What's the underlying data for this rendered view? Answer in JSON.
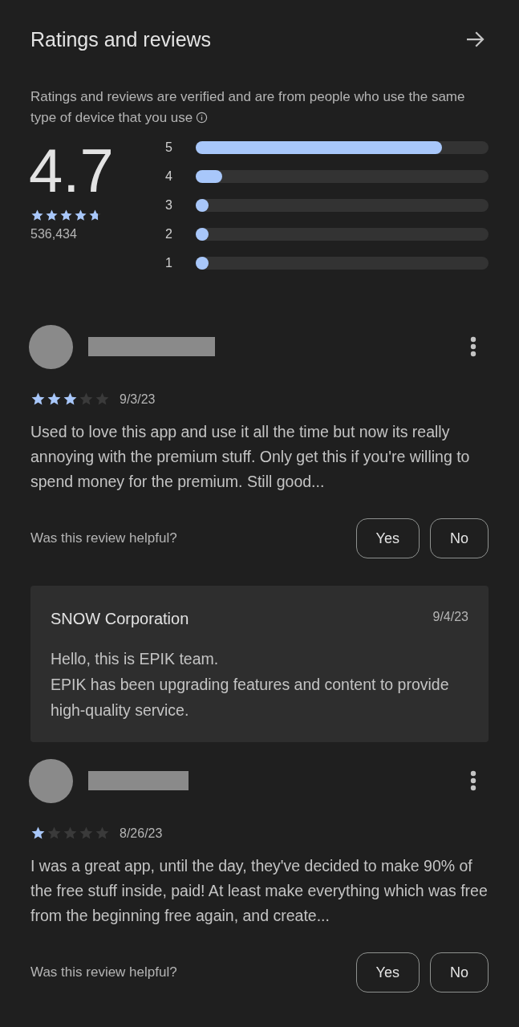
{
  "header": {
    "title": "Ratings and reviews"
  },
  "notice": "Ratings and reviews are verified and are from people who use the same type of device that you use",
  "summary": {
    "score": "4.7",
    "stars": 4.7,
    "count": "536,434"
  },
  "distribution": [
    {
      "label": "5",
      "level": 0.84
    },
    {
      "label": "4",
      "level": 0.09
    },
    {
      "label": "3",
      "level": 0.04
    },
    {
      "label": "2",
      "level": 0.04
    },
    {
      "label": "1",
      "level": 0.04
    }
  ],
  "reviews": [
    {
      "stars": 3,
      "date": "9/3/23",
      "text": "Used to love this app and use it all the time but now its really annoying with the premium stuff. Only get this if you're willing to spend money for the premium. Still good...",
      "helpful_prompt": "Was this review helpful?",
      "buttons": [
        "Yes",
        "No"
      ],
      "reply": {
        "author": "SNOW Corporation",
        "date": "9/4/23",
        "text": "Hello, this is EPIK team.\nEPIK has been upgrading features and content to provide high-quality service."
      }
    },
    {
      "stars": 1,
      "date": "8/26/23",
      "text": "I was a great app, until the day, they've decided to make 90% of the free stuff inside, paid! At least make everything which was free from the beginning free again, and create...",
      "helpful_prompt": "Was this review helpful?",
      "buttons": [
        "Yes",
        "No"
      ]
    }
  ]
}
